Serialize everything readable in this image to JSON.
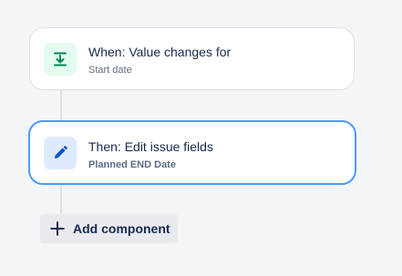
{
  "trigger": {
    "title": "When: Value changes for",
    "subtitle": "Start date",
    "icon": "field-value-changed-icon",
    "icon_color": "#00875a",
    "tile_color": "#e3fcef"
  },
  "action": {
    "title": "Then: Edit issue fields",
    "subtitle": "Planned END Date",
    "icon": "pencil-icon",
    "icon_color": "#0052cc",
    "tile_color": "#deebff",
    "selected_border_color": "#4c9aff"
  },
  "add_component": {
    "label": "Add component",
    "icon": "plus-icon"
  }
}
